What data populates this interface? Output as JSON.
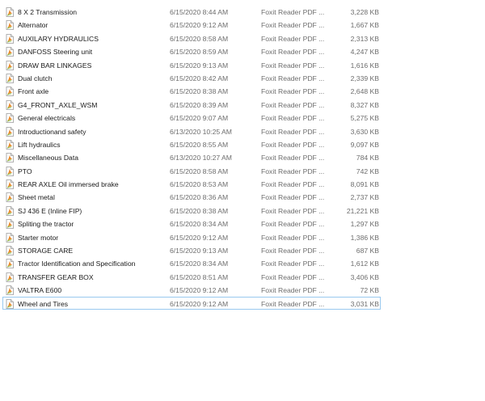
{
  "files": [
    {
      "name": "8 X 2 Transmission",
      "date": "6/15/2020 8:44 AM",
      "type": "Foxit Reader PDF ...",
      "size": "3,228 KB"
    },
    {
      "name": "Alternator",
      "date": "6/15/2020 9:12 AM",
      "type": "Foxit Reader PDF ...",
      "size": "1,667 KB"
    },
    {
      "name": "AUXILARY HYDRAULICS",
      "date": "6/15/2020 8:58 AM",
      "type": "Foxit Reader PDF ...",
      "size": "2,313 KB"
    },
    {
      "name": "DANFOSS Steering unit",
      "date": "6/15/2020 8:59 AM",
      "type": "Foxit Reader PDF ...",
      "size": "4,247 KB"
    },
    {
      "name": "DRAW BAR LINKAGES",
      "date": "6/15/2020 9:13 AM",
      "type": "Foxit Reader PDF ...",
      "size": "1,616 KB"
    },
    {
      "name": "Dual clutch",
      "date": "6/15/2020 8:42 AM",
      "type": "Foxit Reader PDF ...",
      "size": "2,339 KB"
    },
    {
      "name": "Front axle",
      "date": "6/15/2020 8:38 AM",
      "type": "Foxit Reader PDF ...",
      "size": "2,648 KB"
    },
    {
      "name": "G4_FRONT_AXLE_WSM",
      "date": "6/15/2020 8:39 AM",
      "type": "Foxit Reader PDF ...",
      "size": "8,327 KB"
    },
    {
      "name": "General electricals",
      "date": "6/15/2020 9:07 AM",
      "type": "Foxit Reader PDF ...",
      "size": "5,275 KB"
    },
    {
      "name": "Introductionand safety",
      "date": "6/13/2020 10:25 AM",
      "type": "Foxit Reader PDF ...",
      "size": "3,630 KB"
    },
    {
      "name": "Lift hydraulics",
      "date": "6/15/2020 8:55 AM",
      "type": "Foxit Reader PDF ...",
      "size": "9,097 KB"
    },
    {
      "name": "Miscellaneous Data",
      "date": "6/13/2020 10:27 AM",
      "type": "Foxit Reader PDF ...",
      "size": "784 KB"
    },
    {
      "name": "PTO",
      "date": "6/15/2020 8:58 AM",
      "type": "Foxit Reader PDF ...",
      "size": "742 KB"
    },
    {
      "name": "REAR AXLE Oil immersed brake",
      "date": "6/15/2020 8:53 AM",
      "type": "Foxit Reader PDF ...",
      "size": "8,091 KB"
    },
    {
      "name": "Sheet metal",
      "date": "6/15/2020 8:36 AM",
      "type": "Foxit Reader PDF ...",
      "size": "2,737 KB"
    },
    {
      "name": "SJ 436 E (Inline FIP)",
      "date": "6/15/2020 8:38 AM",
      "type": "Foxit Reader PDF ...",
      "size": "21,221 KB"
    },
    {
      "name": "Spliting the tractor",
      "date": "6/15/2020 8:34 AM",
      "type": "Foxit Reader PDF ...",
      "size": "1,297 KB"
    },
    {
      "name": "Starter motor",
      "date": "6/15/2020 9:12 AM",
      "type": "Foxit Reader PDF ...",
      "size": "1,386 KB"
    },
    {
      "name": "STORAGE CARE",
      "date": "6/15/2020 9:13 AM",
      "type": "Foxit Reader PDF ...",
      "size": "687 KB"
    },
    {
      "name": "Tractor Identification and Specification",
      "date": "6/15/2020 8:34 AM",
      "type": "Foxit Reader PDF ...",
      "size": "1,612 KB"
    },
    {
      "name": "TRANSFER GEAR BOX",
      "date": "6/15/2020 8:51 AM",
      "type": "Foxit Reader PDF ...",
      "size": "3,406 KB"
    },
    {
      "name": "VALTRA E600",
      "date": "6/15/2020 9:12 AM",
      "type": "Foxit Reader PDF ...",
      "size": "72 KB"
    },
    {
      "name": "Wheel and Tires",
      "date": "6/15/2020 9:12 AM",
      "type": "Foxit Reader PDF ...",
      "size": "3,031 KB"
    }
  ],
  "selected_index": 22,
  "icon": "foxit-pdf-file-icon",
  "colors": {
    "selection_border": "#99c9ef",
    "icon_orange": "#e8892b",
    "icon_green": "#7fb63f",
    "secondary_text": "#6d6d6d"
  }
}
